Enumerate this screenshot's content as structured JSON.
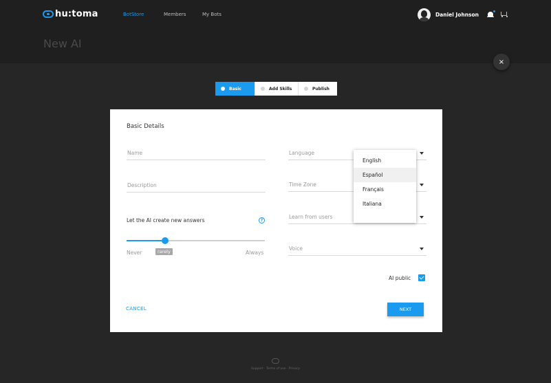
{
  "header": {
    "logo_text": "hu:toma",
    "nav": [
      {
        "label": "BotStore",
        "active": true
      },
      {
        "label": "Members",
        "active": false
      },
      {
        "label": "My Bots",
        "active": false
      }
    ],
    "user_name": "Daniel Johnson"
  },
  "page": {
    "title": "New AI",
    "close_symbol": "×"
  },
  "stepper": {
    "steps": [
      {
        "label": "Basic",
        "active": true
      },
      {
        "label": "Add Skills",
        "active": false
      },
      {
        "label": "Publish",
        "active": false
      }
    ]
  },
  "form": {
    "section_title": "Basic Details",
    "name_label": "Name",
    "description_label": "Description",
    "language_label": "Language",
    "timezone_label": "Time Zone",
    "learn_label": "Learn from users",
    "voice_label": "Voice",
    "slider": {
      "label": "Let the AI create new answers",
      "help_symbol": "?",
      "min_label": "Never",
      "max_label": "Always",
      "value_label": "rarely",
      "value_fraction": 0.28
    },
    "public_label": "AI public",
    "public_checked": true,
    "cancel_label": "CANCEL",
    "next_label": "NEXT"
  },
  "language_menu": {
    "options": [
      "English",
      "Español",
      "Français",
      "Italiana"
    ],
    "hovered_index": 1
  },
  "footer": {
    "links": "Support · Terms of use · Privacy"
  },
  "colors": {
    "accent": "#1a9bf0",
    "background": "#262626",
    "header": "#1f1f1f"
  }
}
